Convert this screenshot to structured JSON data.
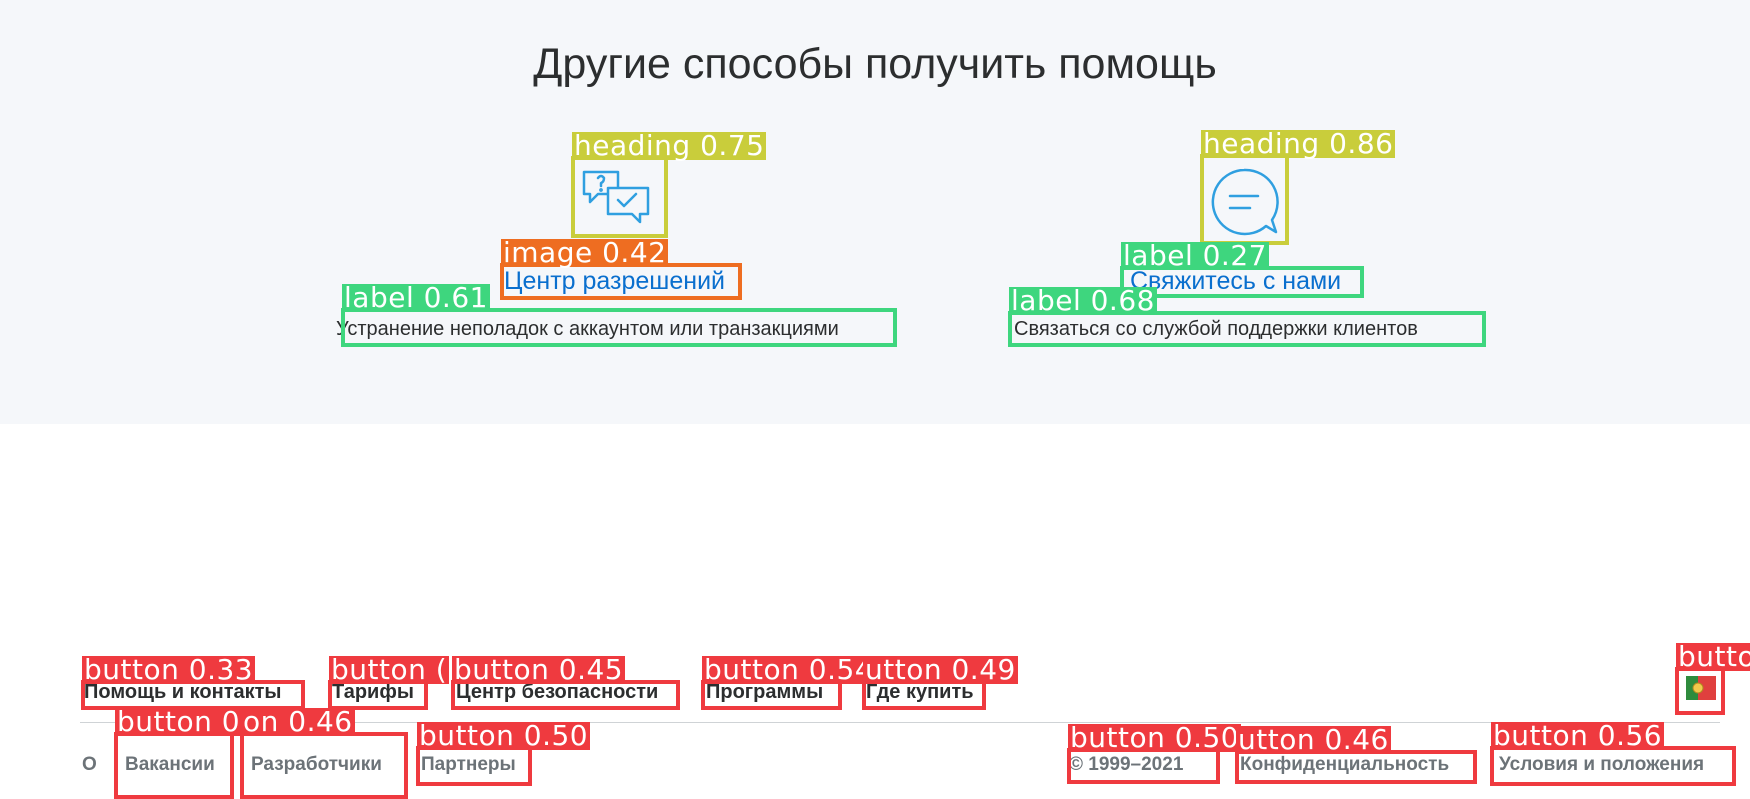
{
  "help": {
    "title": "Другие способы получить помощь",
    "cards": [
      {
        "icon": "chat-question-check-icon",
        "link": "Центр разрешений",
        "description": "Устранение неполадок с аккаунтом или транзакциями"
      },
      {
        "icon": "chat-bubble-icon",
        "link": "Свяжитесь с нами",
        "description": "Связаться со службой поддержки клиентов"
      }
    ]
  },
  "annotations": {
    "heading_1": "heading 0.75",
    "heading_2": "heading 0.86",
    "image_1": "image 0.42",
    "label_link_2": "label 0.27",
    "label_desc_1": "label 0.61",
    "label_desc_2": "label 0.68",
    "btn_help": "button 0.33",
    "btn_tariffs": "button (",
    "btn_security": "button 0.45",
    "btn_programs": "button 0.54",
    "btn_where": "utton 0.49",
    "btn_flag": "butto",
    "btn_jobs": "button 0.58",
    "btn_devs": "on 0.46",
    "btn_partners": "button 0.50",
    "btn_copyright": "button 0.50",
    "btn_privacy": "utton 0.46",
    "btn_terms": "button 0.56"
  },
  "footer": {
    "top_links": [
      "Помощь и контакты",
      "Тарифы",
      "Центр безопасности",
      "Программы",
      "Где купить"
    ],
    "bottom_cut": "О",
    "bottom_links": [
      "Вакансии",
      "Разработчики",
      "Партнеры"
    ],
    "copyright": "© 1999–2021",
    "privacy": "Конфиденциальность",
    "terms": "Условия и положения",
    "flag_icon": "portugal-flag-icon"
  },
  "colors": {
    "link": "#0a6fce",
    "icon": "#2f9fe0",
    "heading_box": "#c9cd3b",
    "label_box": "#3ed67e",
    "image_box": "#ee6d21",
    "button_box": "#ef3a3f"
  }
}
